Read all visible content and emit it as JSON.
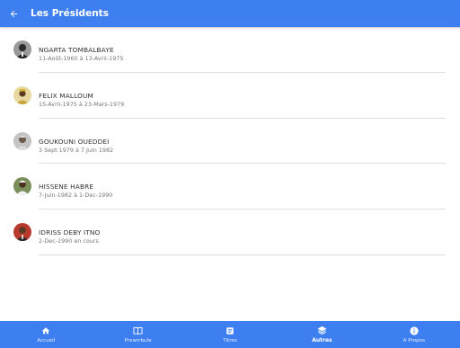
{
  "header": {
    "title": "Les Présidents",
    "back_icon": "arrow-back-icon"
  },
  "presidents": [
    {
      "name": "NGARTA TOMBALBAYE",
      "dates": "11-Août-1960 à 13-Avril-1975"
    },
    {
      "name": "FELIX MALLOUM",
      "dates": "15-Avril-1975 à 23-Mars-1979"
    },
    {
      "name": "GOUKOUNI OUEDDEI",
      "dates": "3 Sept 1979 à 7 Juin 1982"
    },
    {
      "name": "HISSENE HABRE",
      "dates": "7-Juin-1982 à 1-Dec-1990"
    },
    {
      "name": "IDRISS DEBY ITNO",
      "dates": "2-Dec-1990 en cours"
    }
  ],
  "nav": [
    {
      "label": "Accueil",
      "icon": "home-icon"
    },
    {
      "label": "Preambule",
      "icon": "book-icon"
    },
    {
      "label": "Titres",
      "icon": "list-icon"
    },
    {
      "label": "Autres",
      "icon": "layers-icon",
      "active": true
    },
    {
      "label": "A Propos",
      "icon": "info-icon"
    }
  ],
  "colors": {
    "primary": "#3d7ff0",
    "divider": "#e0e0e0"
  }
}
